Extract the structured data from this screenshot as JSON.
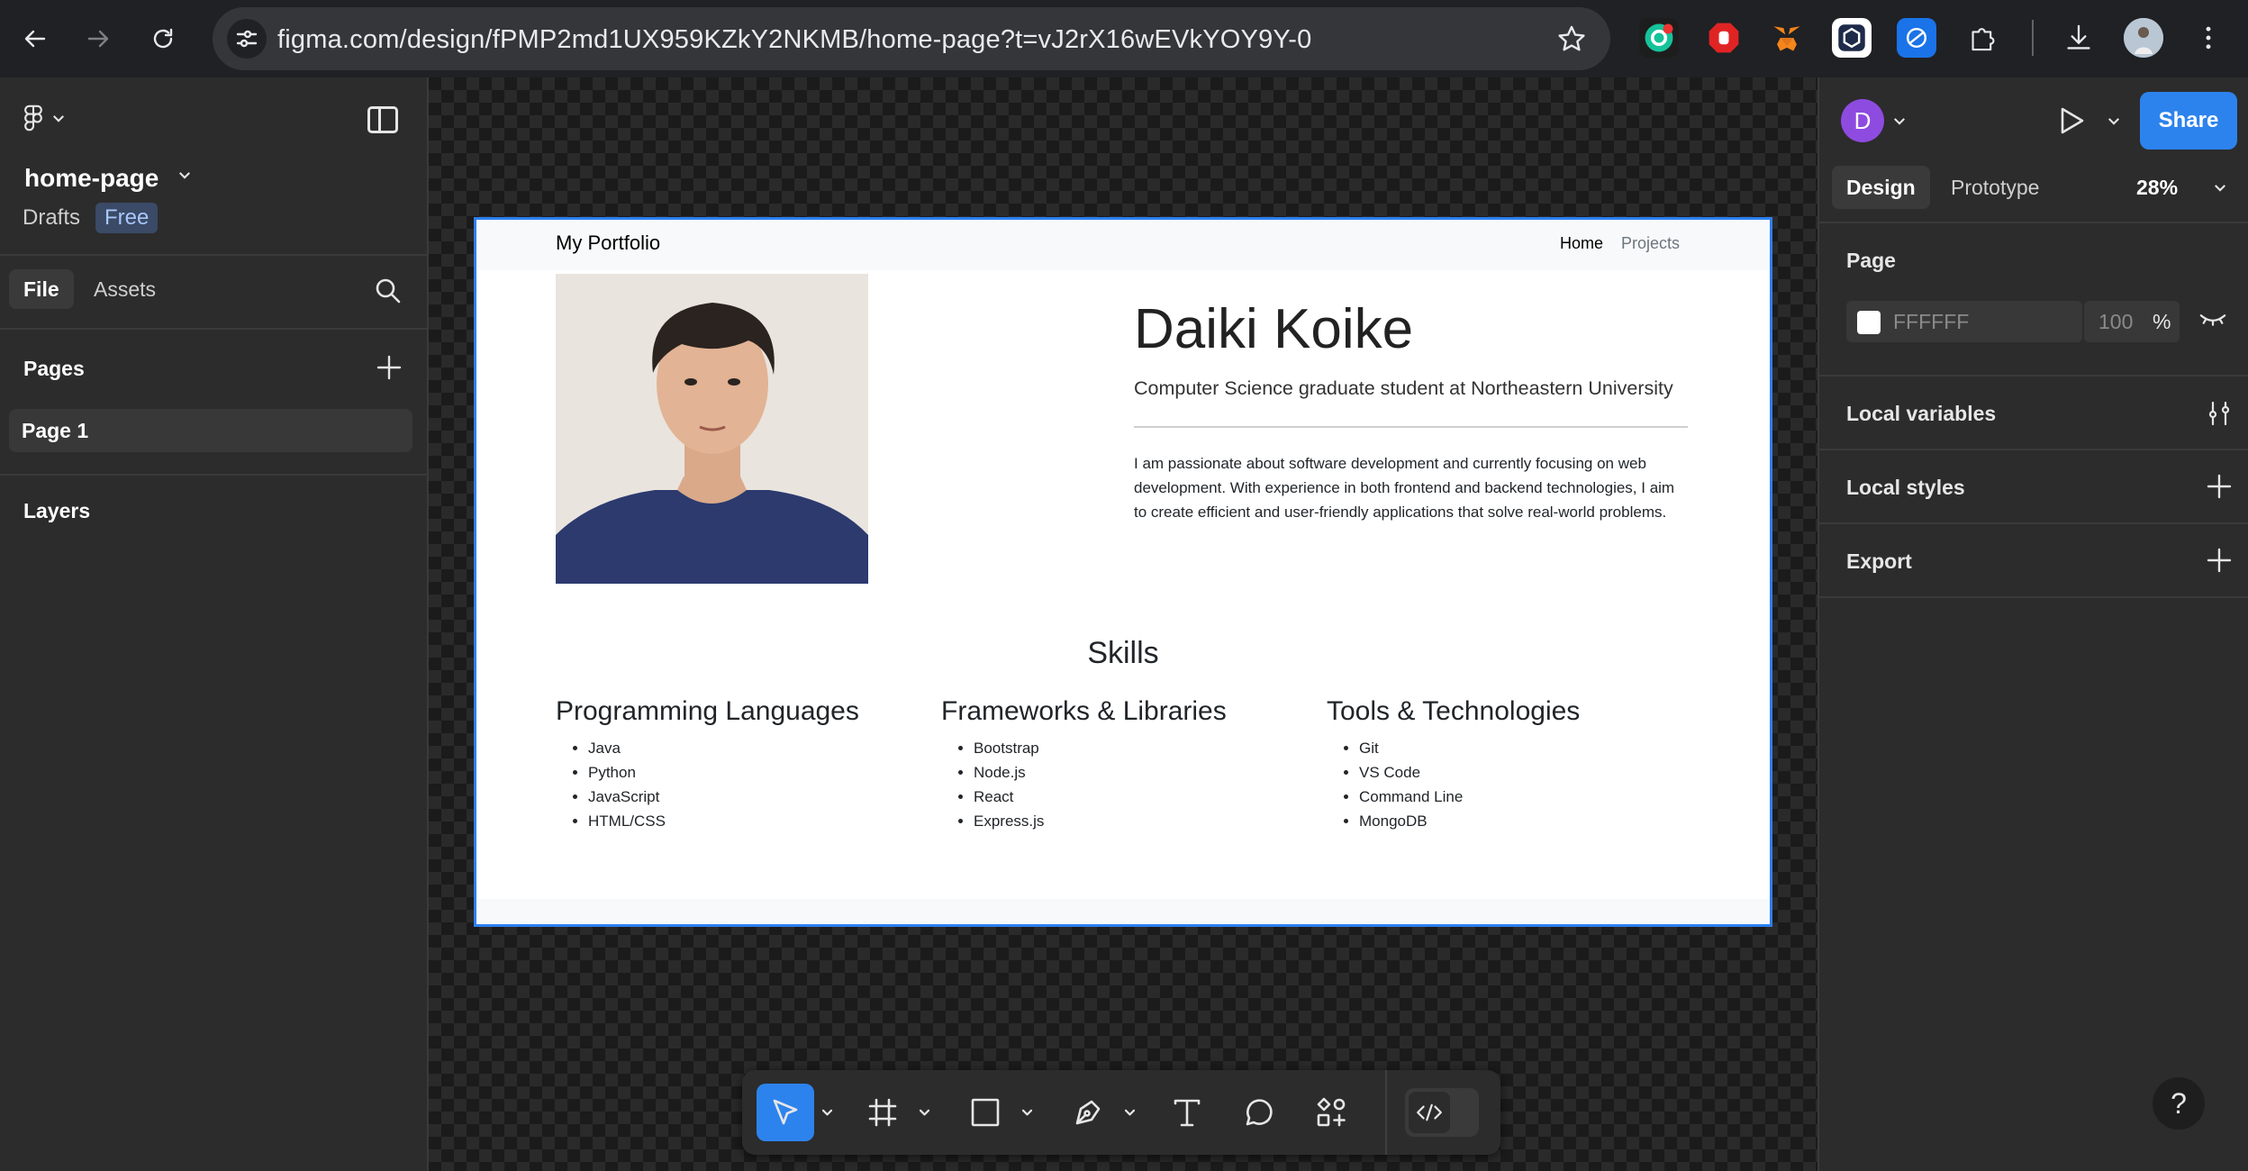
{
  "browser": {
    "url": "figma.com/design/fPMP2md1UX959KZkY2NKMB/home-page?t=vJ2rX16wEVkYOY9Y-0"
  },
  "left_panel": {
    "file_name": "home-page",
    "location": "Drafts",
    "plan_badge": "Free",
    "tabs": [
      "File",
      "Assets"
    ],
    "pages_title": "Pages",
    "pages": [
      "Page 1"
    ],
    "layers_title": "Layers"
  },
  "frame": {
    "nav": {
      "brand": "My Portfolio",
      "links": [
        "Home",
        "Projects"
      ]
    },
    "hero": {
      "name": "Daiki Koike",
      "subtitle": "Computer Science graduate student at Northeastern University",
      "bio": "I am passionate about software development and currently focusing on web development. With experience in both frontend and backend technologies, I aim to create efficient and user-friendly applications that solve real-world problems."
    },
    "skills": {
      "title": "Skills",
      "columns": [
        {
          "heading": "Programming Languages",
          "items": [
            "Java",
            "Python",
            "JavaScript",
            "HTML/CSS"
          ]
        },
        {
          "heading": "Frameworks & Libraries",
          "items": [
            "Bootstrap",
            "Node.js",
            "React",
            "Express.js"
          ]
        },
        {
          "heading": "Tools & Technologies",
          "items": [
            "Git",
            "VS Code",
            "Command Line",
            "MongoDB"
          ]
        }
      ]
    }
  },
  "right_panel": {
    "avatar_initial": "D",
    "share_label": "Share",
    "tabs": [
      "Design",
      "Prototype"
    ],
    "zoom": "28%",
    "page_title": "Page",
    "page_color_hex": "FFFFFF",
    "page_opacity": "100",
    "opacity_unit": "%",
    "sections": [
      "Local variables",
      "Local styles",
      "Export"
    ]
  },
  "help_label": "?",
  "colors": {
    "accent": "#2d83ed",
    "selection": "#2d7ff0",
    "avatar": "#8e4be0"
  },
  "icons": {
    "toolbar": [
      "move-icon",
      "frame-icon",
      "rectangle-icon",
      "pen-icon",
      "text-icon",
      "comment-icon",
      "actions-icon",
      "dev-mode-icon"
    ]
  }
}
